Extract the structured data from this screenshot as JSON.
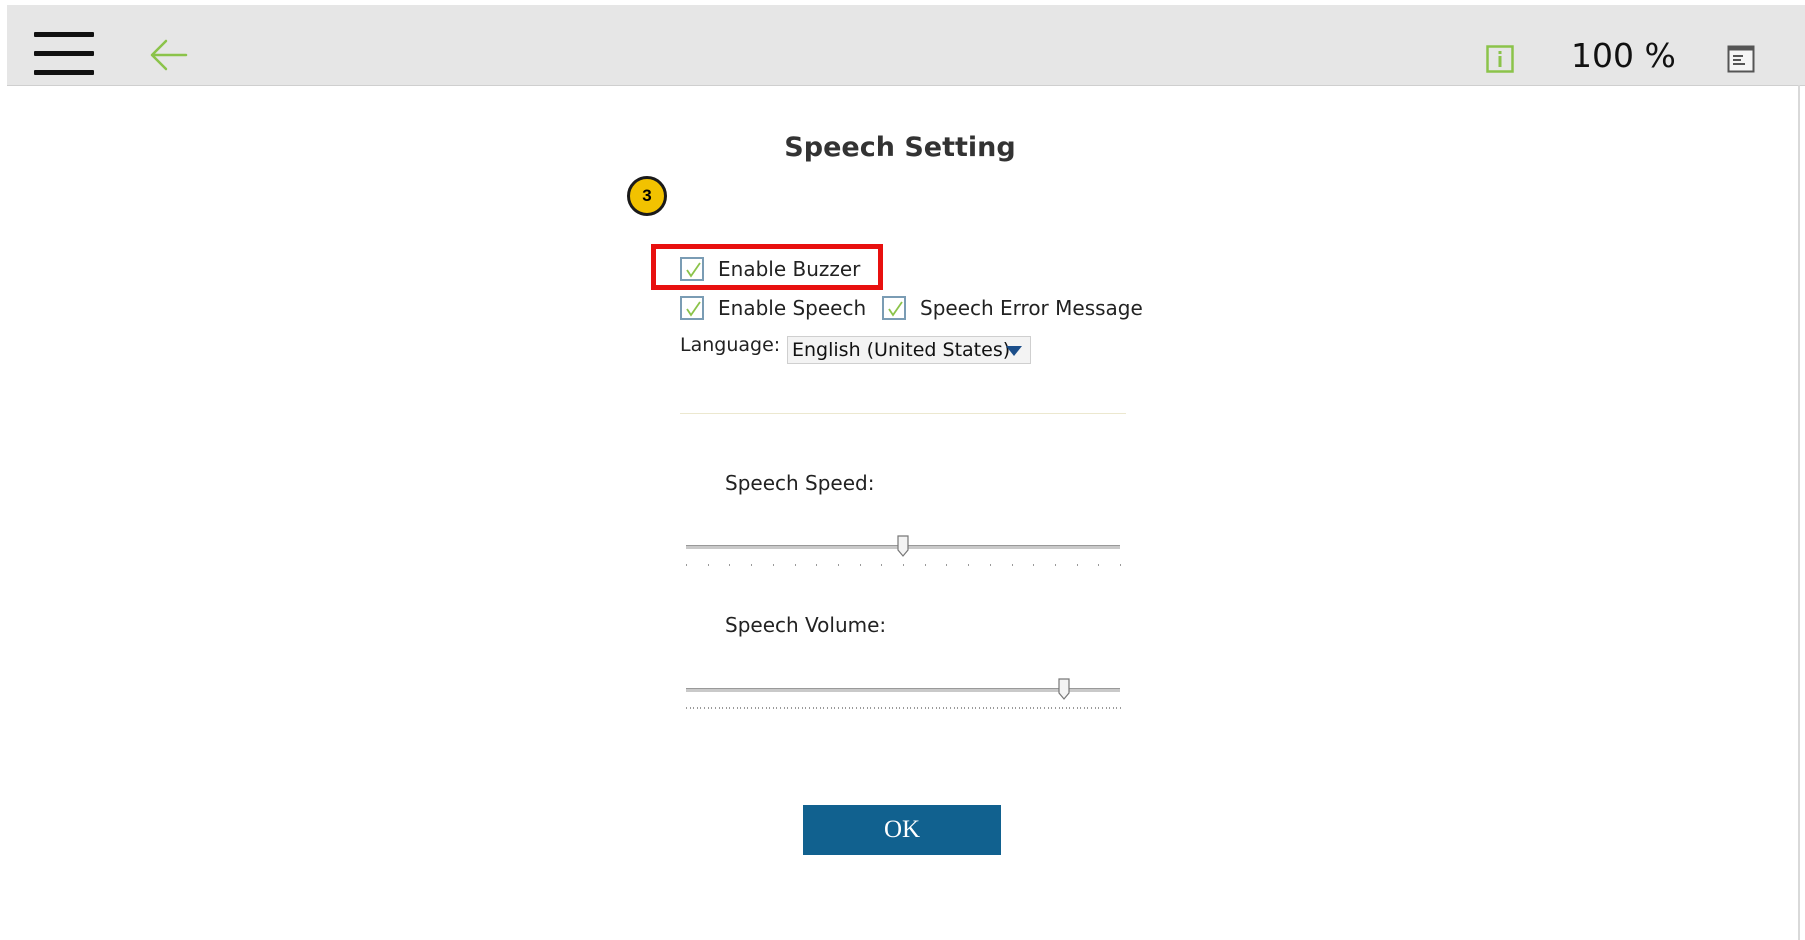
{
  "header": {
    "menu_icon": "hamburger-menu-icon",
    "back_icon": "back-arrow-icon",
    "info_icon": "info-icon",
    "zoom_level": "100 %",
    "window_icon": "window-icon",
    "accent_color": "#8bc34a"
  },
  "dialog": {
    "title": "Speech Setting",
    "step_badge": "3",
    "enable_buzzer": {
      "label": "Enable Buzzer",
      "checked": true
    },
    "enable_speech": {
      "label": "Enable Speech",
      "checked": true
    },
    "speech_error_message": {
      "label": "Speech Error Message",
      "checked": true
    },
    "language_label": "Language:",
    "language_value": "English (United States)",
    "speech_speed": {
      "label": "Speech Speed:",
      "value": 0.5
    },
    "speech_volume": {
      "label": "Speech Volume:",
      "value": 0.87
    },
    "ok_label": "OK"
  },
  "colors": {
    "highlight_box": "#e8100f",
    "badge": "#f2c200",
    "ok_button": "#11618f",
    "checkmark": "#8bc34a"
  }
}
